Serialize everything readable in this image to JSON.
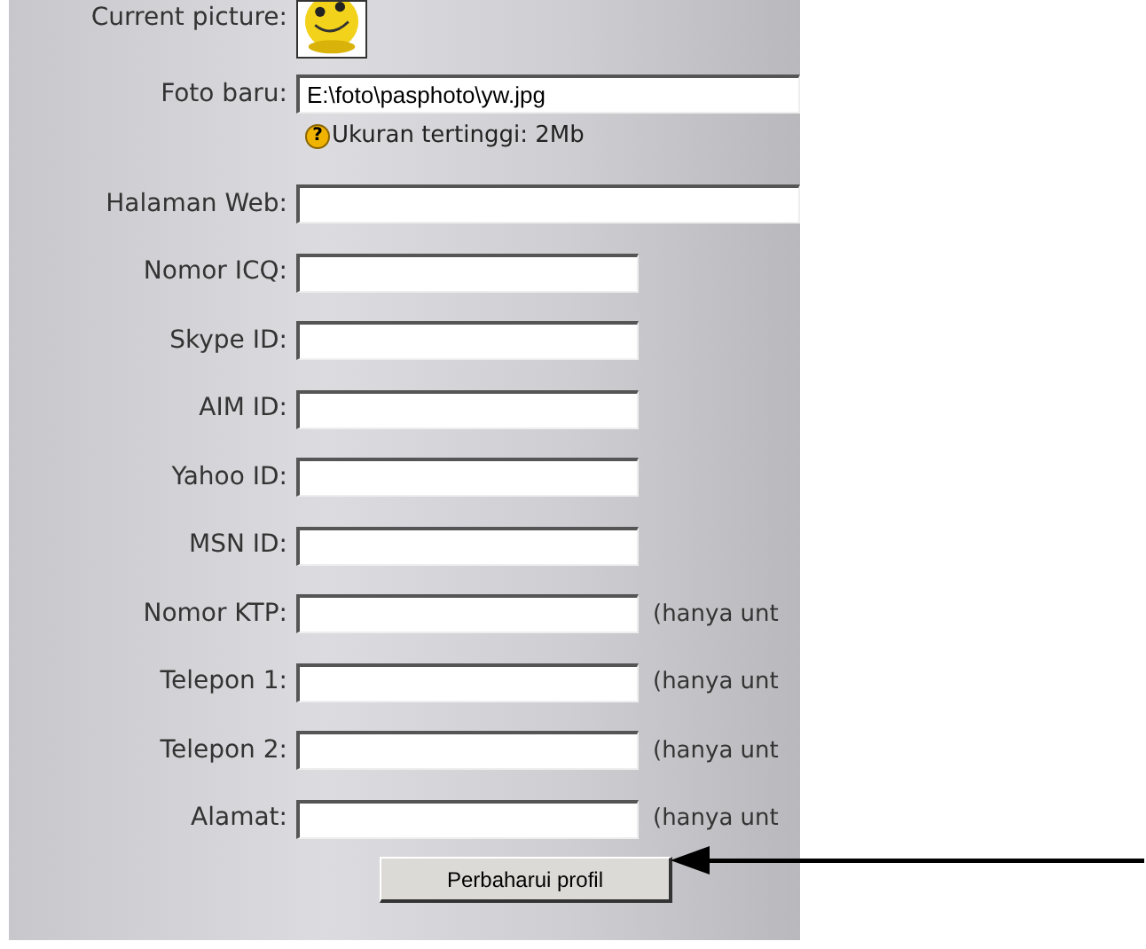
{
  "current_picture": {
    "label": "Current picture:"
  },
  "new_photo": {
    "label": "Foto baru:",
    "value": "E:\\foto\\pasphoto\\yw.jpg",
    "hint_icon": "?",
    "hint": "Ukuran tertinggi: 2Mb"
  },
  "fields": [
    {
      "label": "Halaman Web:",
      "kind": "wide"
    },
    {
      "label": "Nomor ICQ:",
      "kind": "narrow"
    },
    {
      "label": "Skype ID:",
      "kind": "narrow"
    },
    {
      "label": "AIM ID:",
      "kind": "narrow"
    },
    {
      "label": "Yahoo ID:",
      "kind": "narrow"
    },
    {
      "label": "MSN ID:",
      "kind": "narrow"
    },
    {
      "label": "Nomor KTP:",
      "kind": "narrow",
      "note": "(hanya unt"
    },
    {
      "label": "Telepon 1:",
      "kind": "narrow",
      "note": "(hanya unt"
    },
    {
      "label": "Telepon 2:",
      "kind": "narrow",
      "note": "(hanya unt"
    },
    {
      "label": "Alamat:",
      "kind": "narrow",
      "note": "(hanya unt"
    }
  ],
  "submit": {
    "label": "Perbaharui profil"
  }
}
